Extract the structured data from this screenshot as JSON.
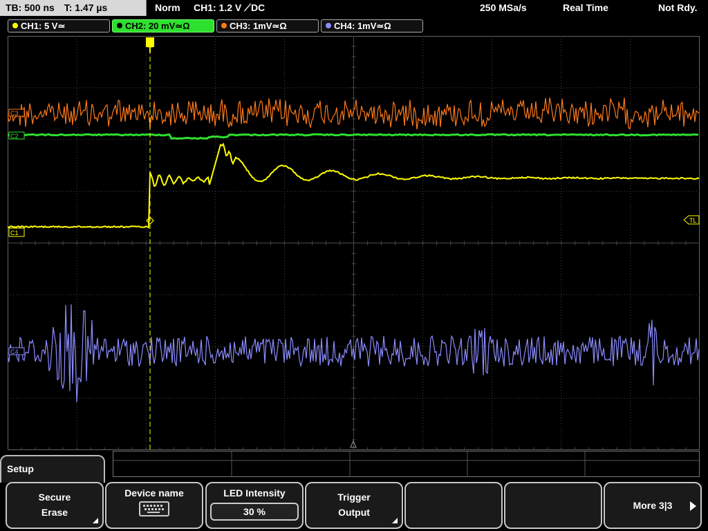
{
  "topbar": {
    "timebase": "TB: 500 ns",
    "trigger_time": "T: 1.47 µs",
    "mode": "Norm",
    "trigger_info": "CH1: 1.2 V ⟋DC",
    "sample_rate": "250 MSa/s",
    "acq_mode": "Real Time",
    "state": "Not Rdy."
  },
  "channels": [
    {
      "label": "CH1: 5 V≃",
      "color": "#ffff00"
    },
    {
      "label": "CH2: 20 mV≃Ω",
      "color": "#2ee02e",
      "active": true
    },
    {
      "label": "CH3: 1mV≃Ω",
      "color": "#ff7a1a"
    },
    {
      "label": "CH4: 1mV≃Ω",
      "color": "#8c8cff"
    }
  ],
  "markers": {
    "c1": "C1",
    "c2": "C2",
    "c3": "C3",
    "c4": "C4",
    "trigger_level": "TL",
    "trigger_pos": "T"
  },
  "menu": {
    "title": "Setup",
    "softkeys": [
      {
        "line1": "Secure",
        "line2": "Erase",
        "icon": "submenu-corner-icon"
      },
      {
        "line1": "Device name",
        "icon": "keyboard-icon"
      },
      {
        "line1": "LED Intensity",
        "value": "30 %"
      },
      {
        "line1": "Trigger",
        "line2": "Output",
        "icon": "submenu-corner-icon"
      },
      {
        "line1": ""
      },
      {
        "line1": ""
      },
      {
        "line1": "More 3|3",
        "icon": "right-arrow-icon"
      }
    ]
  },
  "colors": {
    "ch1": "#ffff00",
    "ch2": "#2ee02e",
    "ch3": "#ff7a1a",
    "ch4": "#8c8cff",
    "grid": "#4a4a4a"
  }
}
